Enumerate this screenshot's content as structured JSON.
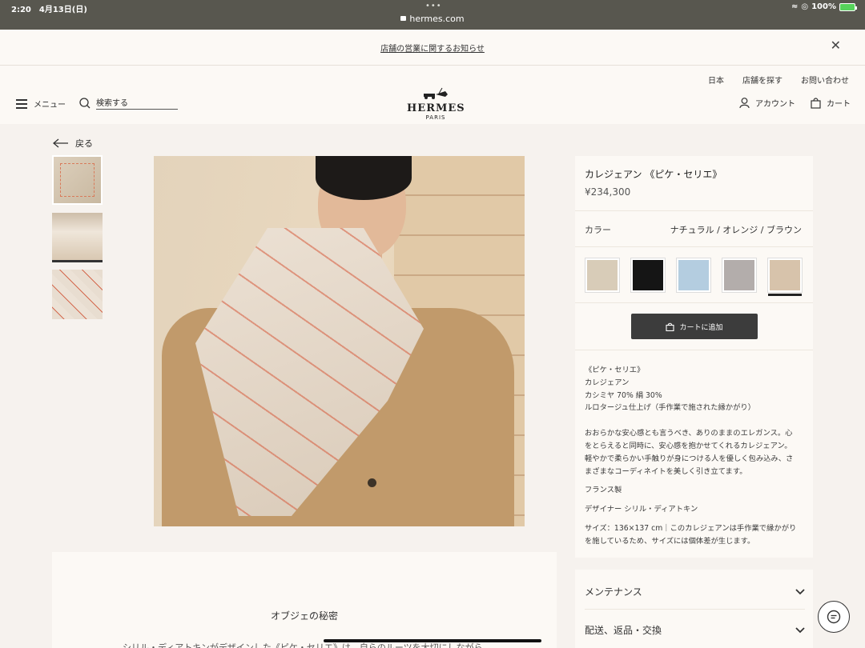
{
  "status_bar": {
    "time_date": "2:20　4月13日(日)",
    "dots": "•••",
    "url": "hermes.com",
    "battery": "100%"
  },
  "notice": {
    "text": "店舗の営業に関するお知らせ",
    "close": "✕"
  },
  "header": {
    "top_links": [
      "日本",
      "店舗を探す",
      "お問い合わせ"
    ],
    "menu_label": "メニュー",
    "search_placeholder": "検索する",
    "logo_word": "HERMES",
    "logo_city": "PARIS",
    "account_label": "アカウント",
    "cart_label": "カート"
  },
  "back_label": "戻る",
  "product": {
    "name": "カレジェアン 《ピケ・セリエ》",
    "price": "¥234,300",
    "color_label": "カラー",
    "color_value": "ナチュラル / オレンジ / ブラウン",
    "swatches": [
      {
        "color": "#d8ccb8",
        "selected": false
      },
      {
        "color": "#151515",
        "selected": false
      },
      {
        "color": "#b4cde0",
        "selected": false
      },
      {
        "color": "#b3adab",
        "selected": false
      },
      {
        "color": "#d7c3ab",
        "selected": true
      }
    ],
    "add_to_cart": "カートに追加",
    "description": {
      "l1": "《ピケ・セリエ》",
      "l2": "カレジェアン",
      "l3": "カシミヤ 70% 絹 30%",
      "l4": "ルロタージュ仕上げ（手作業で施された縁かがり）",
      "p1a": "おおらかな安心感とも言うべき、ありのままのエレガンス。心",
      "p1b": "をとらえると同時に、安心感を抱かせてくれるカレジェアン。",
      "p1c": "軽やかで柔らかい手触りが身につける人を優しく包み込み、さ",
      "p1d": "まざまなコーディネイトを美しく引き立てます。",
      "made": "フランス製",
      "designer": "デザイナー シリル・ディアトキン",
      "size_a": "サイズ：136×137 cm｜このカレジェアンは手作業で縁かがり",
      "size_b": "を施しているため、サイズには個体差が生じます。"
    }
  },
  "accordion": [
    "メンテナンス",
    "配送、返品・交換"
  ],
  "story": {
    "title": "オブジェの秘密",
    "text": "シリル・ディアトキンがデザインした《ピケ・セリエ》は、自らのルーツを大切にしながら"
  },
  "colors": {
    "accent": "#3c3c3c",
    "background": "#f6f2ee",
    "card": "#fcf9f5"
  }
}
